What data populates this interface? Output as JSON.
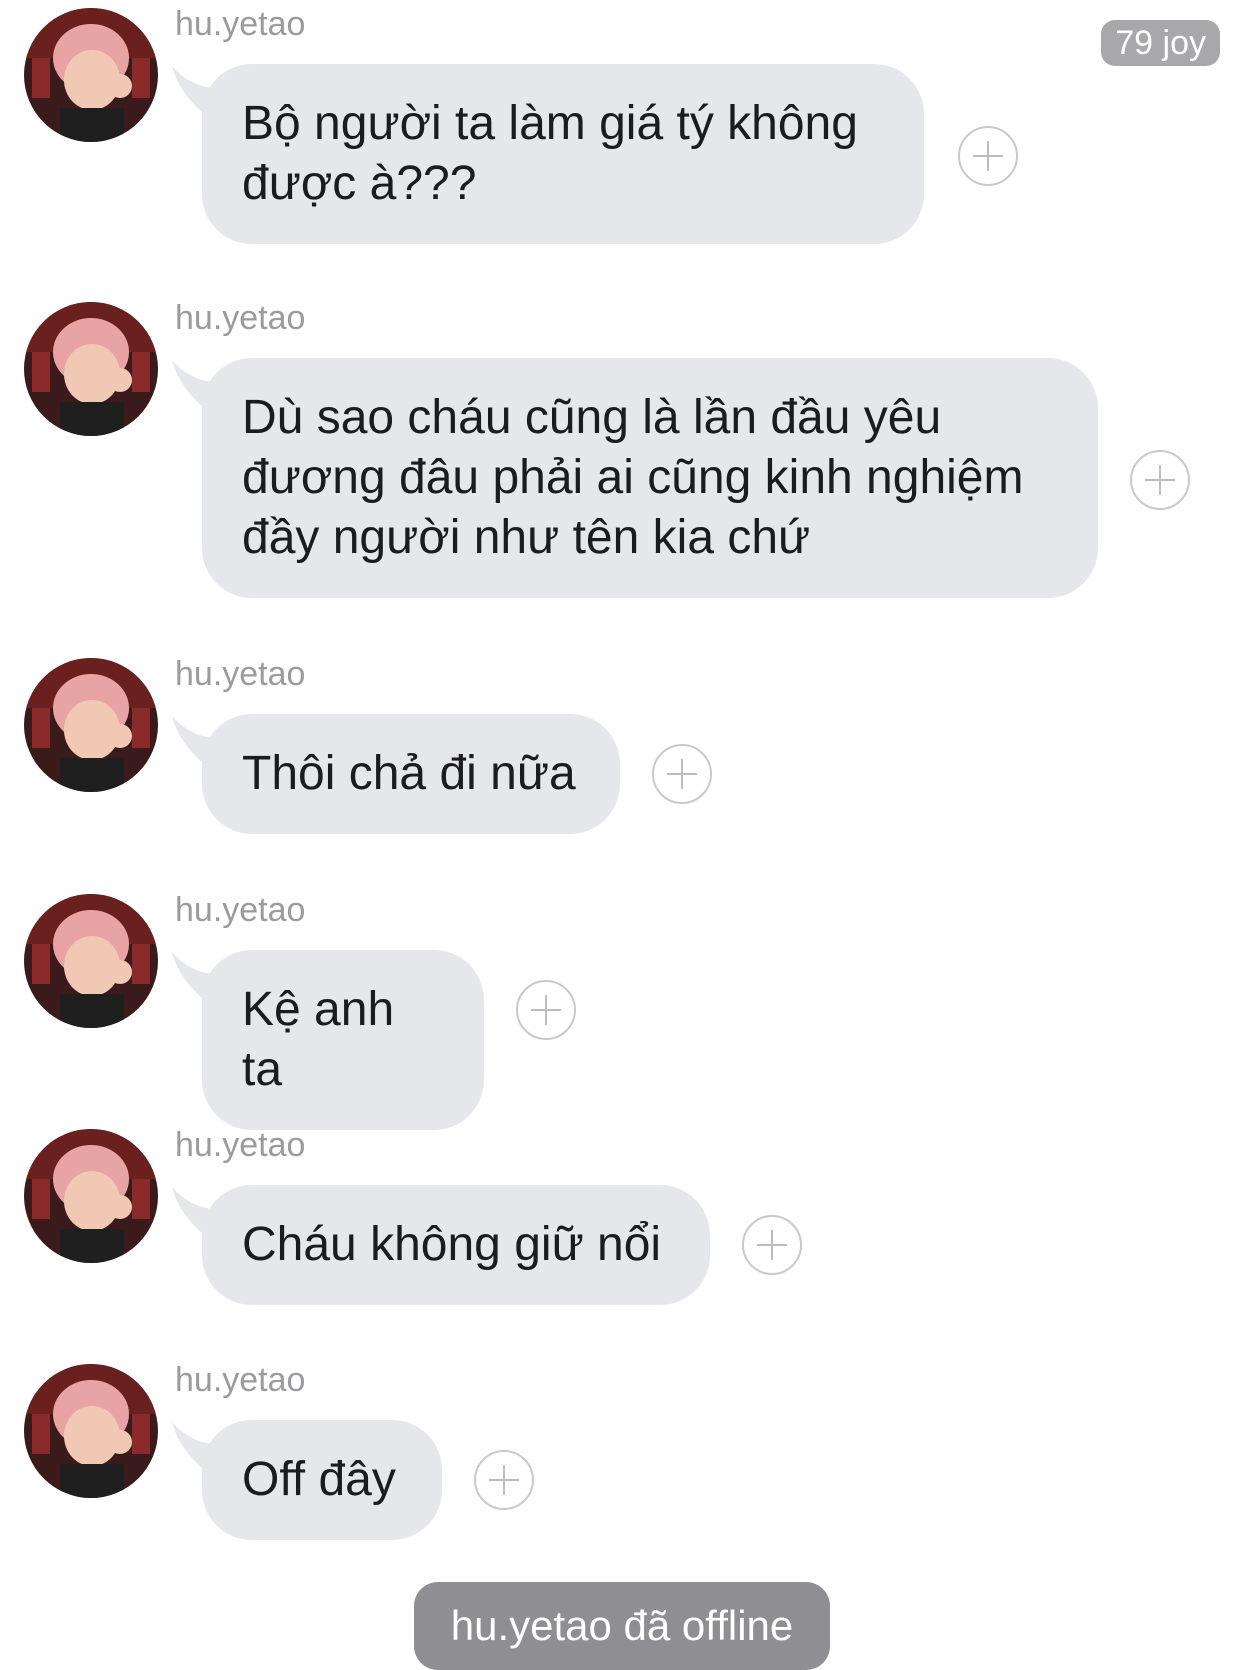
{
  "header": {
    "badge_text": "79 joy"
  },
  "messages": [
    {
      "sender": "hu.yetao",
      "text": "Bộ người ta làm giá tý không được à???"
    },
    {
      "sender": "hu.yetao",
      "text": "Dù sao cháu cũng là lần đầu yêu đương đâu phải ai cũng kinh nghiệm đầy người như tên kia chứ"
    },
    {
      "sender": "hu.yetao",
      "text": "Thôi chả đi nữa"
    },
    {
      "sender": "hu.yetao",
      "text": "Kệ anh ta"
    },
    {
      "sender": "hu.yetao",
      "text": "Cháu không giữ nổi"
    },
    {
      "sender": "hu.yetao",
      "text": "Off đây"
    }
  ],
  "status": {
    "offline_text": "hu.yetao đã offline"
  },
  "icons": {
    "react": "plus-circle-icon",
    "avatar": "avatar-photo"
  },
  "colors": {
    "bubble_bg": "#e6e7eb",
    "sender_name": "#9b9b9f",
    "badge_bg": "#a8a8aa",
    "offline_bg": "#8e8e93"
  }
}
